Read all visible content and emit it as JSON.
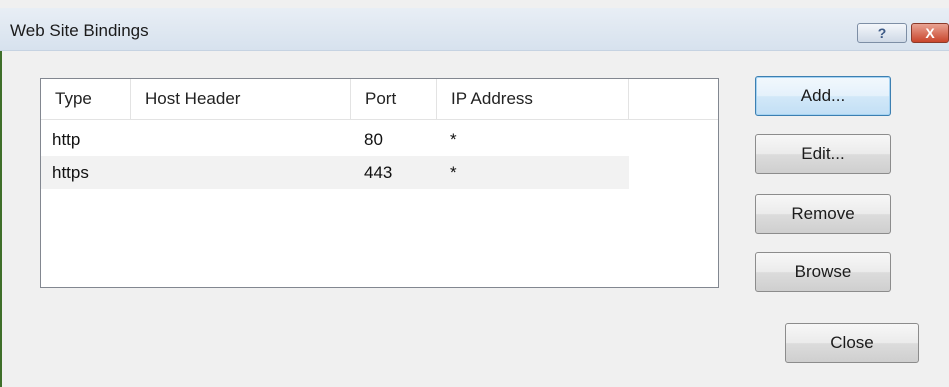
{
  "window": {
    "title": "Web Site Bindings"
  },
  "titlebar_buttons": {
    "help_icon": "?",
    "close_icon": "X"
  },
  "bindings": {
    "columns": [
      "Type",
      "Host Header",
      "Port",
      "IP Address"
    ],
    "rows": [
      {
        "type": "http",
        "host_header": "",
        "port": "80",
        "ip_address": "*"
      },
      {
        "type": "https",
        "host_header": "",
        "port": "443",
        "ip_address": "*"
      }
    ]
  },
  "buttons": {
    "add": "Add...",
    "edit": "Edit...",
    "remove": "Remove",
    "browse": "Browse",
    "close": "Close"
  }
}
